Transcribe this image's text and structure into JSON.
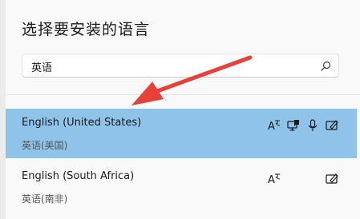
{
  "dialog": {
    "title": "选择要安装的语言"
  },
  "search": {
    "value": "英语",
    "icon": "search-icon"
  },
  "languages": [
    {
      "name": "English (United States)",
      "native": "英语(美国)",
      "selected": true,
      "features": [
        "text-to-speech-icon",
        "display-language-icon",
        "speech-recognition-icon",
        "handwriting-icon"
      ]
    },
    {
      "name": "English (South Africa)",
      "native": "英语(南非)",
      "selected": false,
      "features": [
        "text-to-speech-icon",
        "handwriting-icon"
      ]
    }
  ],
  "colors": {
    "selected_row": "#8fc3ea",
    "arrow": "#e8413a"
  }
}
